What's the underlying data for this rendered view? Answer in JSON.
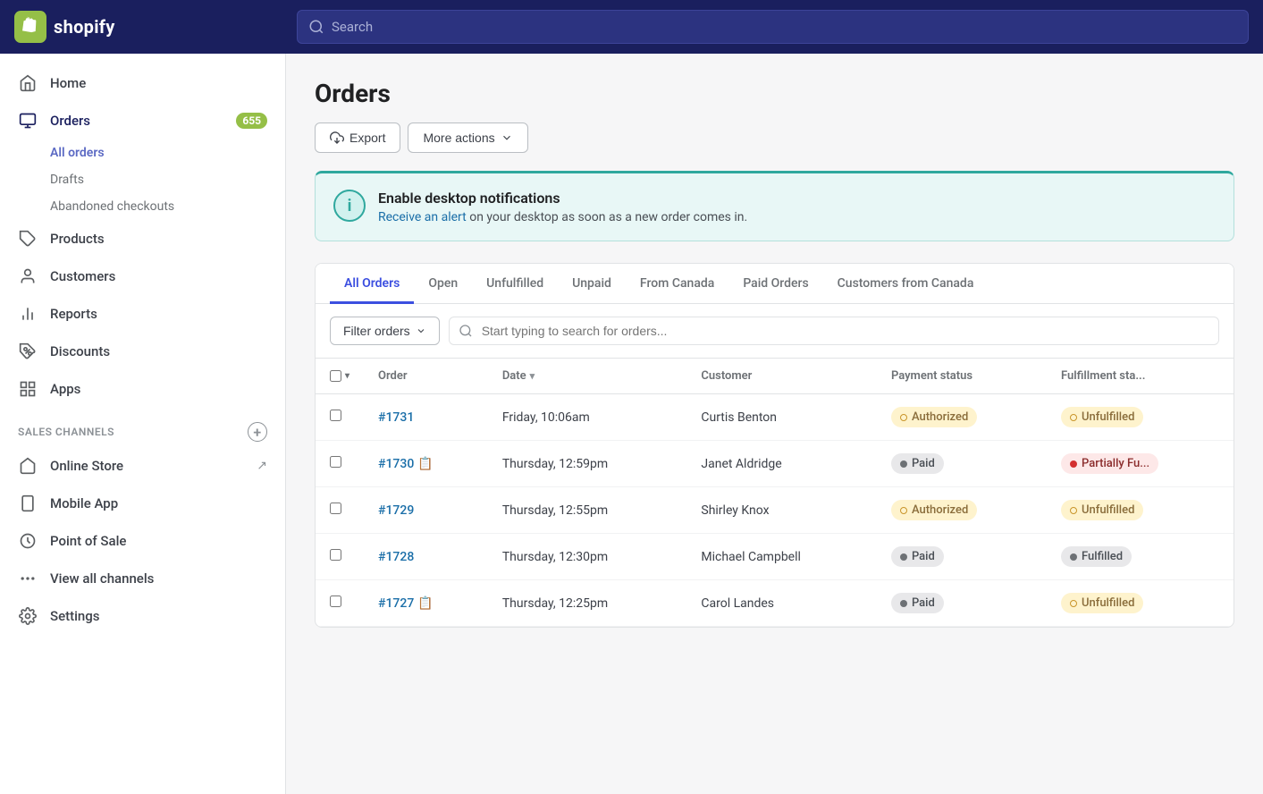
{
  "topNav": {
    "logoText": "shopify",
    "searchPlaceholder": "Search"
  },
  "sidebar": {
    "items": [
      {
        "id": "home",
        "label": "Home",
        "icon": "home"
      },
      {
        "id": "orders",
        "label": "Orders",
        "icon": "orders",
        "badge": "655"
      },
      {
        "id": "products",
        "label": "Products",
        "icon": "products"
      },
      {
        "id": "customers",
        "label": "Customers",
        "icon": "customers"
      },
      {
        "id": "reports",
        "label": "Reports",
        "icon": "reports"
      },
      {
        "id": "discounts",
        "label": "Discounts",
        "icon": "discounts"
      },
      {
        "id": "apps",
        "label": "Apps",
        "icon": "apps"
      }
    ],
    "ordersSubnav": [
      {
        "id": "all-orders",
        "label": "All orders",
        "active": true
      },
      {
        "id": "drafts",
        "label": "Drafts"
      },
      {
        "id": "abandoned",
        "label": "Abandoned checkouts"
      }
    ],
    "salesChannelsHeader": "SALES CHANNELS",
    "salesChannels": [
      {
        "id": "online-store",
        "label": "Online Store",
        "hasExternal": true
      },
      {
        "id": "mobile-app",
        "label": "Mobile App",
        "hasExternal": false
      },
      {
        "id": "pos",
        "label": "Point of Sale",
        "hasExternal": false
      }
    ],
    "viewAllChannels": "View all channels",
    "settings": "Settings"
  },
  "page": {
    "title": "Orders",
    "toolbar": {
      "exportLabel": "Export",
      "moreActionsLabel": "More actions"
    },
    "notification": {
      "title": "Enable desktop notifications",
      "bodyPrefix": "",
      "linkText": "Receive an alert",
      "bodySuffix": " on your desktop as soon as a new order comes in."
    },
    "tabs": [
      {
        "id": "all",
        "label": "All Orders",
        "active": true
      },
      {
        "id": "open",
        "label": "Open"
      },
      {
        "id": "unfulfilled",
        "label": "Unfulfilled"
      },
      {
        "id": "unpaid",
        "label": "Unpaid"
      },
      {
        "id": "from-canada",
        "label": "From Canada"
      },
      {
        "id": "paid-orders",
        "label": "Paid Orders"
      },
      {
        "id": "customers-canada",
        "label": "Customers from Canada"
      }
    ],
    "filterOrdersLabel": "Filter orders",
    "searchPlaceholder": "Start typing to search for orders...",
    "table": {
      "columns": [
        {
          "id": "order",
          "label": "Order",
          "sortable": false
        },
        {
          "id": "date",
          "label": "Date",
          "sortable": true
        },
        {
          "id": "customer",
          "label": "Customer",
          "sortable": false
        },
        {
          "id": "paymentStatus",
          "label": "Payment status",
          "sortable": false
        },
        {
          "id": "fulfillmentStatus",
          "label": "Fulfillment sta...",
          "sortable": false
        }
      ],
      "rows": [
        {
          "id": "1731",
          "orderNum": "#1731",
          "date": "Friday, 10:06am",
          "customer": "Curtis Benton",
          "paymentStatus": "Authorized",
          "paymentType": "authorized",
          "fulfillmentStatus": "Unfulfilled",
          "fulfillmentType": "unfulfilled",
          "hasNote": false
        },
        {
          "id": "1730",
          "orderNum": "#1730",
          "date": "Thursday, 12:59pm",
          "customer": "Janet Aldridge",
          "paymentStatus": "Paid",
          "paymentType": "paid",
          "fulfillmentStatus": "Partially Fu...",
          "fulfillmentType": "partially",
          "hasNote": true
        },
        {
          "id": "1729",
          "orderNum": "#1729",
          "date": "Thursday, 12:55pm",
          "customer": "Shirley Knox",
          "paymentStatus": "Authorized",
          "paymentType": "authorized",
          "fulfillmentStatus": "Unfulfilled",
          "fulfillmentType": "unfulfilled",
          "hasNote": false
        },
        {
          "id": "1728",
          "orderNum": "#1728",
          "date": "Thursday, 12:30pm",
          "customer": "Michael Campbell",
          "paymentStatus": "Paid",
          "paymentType": "paid",
          "fulfillmentStatus": "Fulfilled",
          "fulfillmentType": "fulfilled",
          "hasNote": false
        },
        {
          "id": "1727",
          "orderNum": "#1727",
          "date": "Thursday, 12:25pm",
          "customer": "Carol Landes",
          "paymentStatus": "Paid",
          "paymentType": "paid",
          "fulfillmentStatus": "Unfulfilled",
          "fulfillmentType": "unfulfilled",
          "hasNote": true
        }
      ]
    }
  }
}
